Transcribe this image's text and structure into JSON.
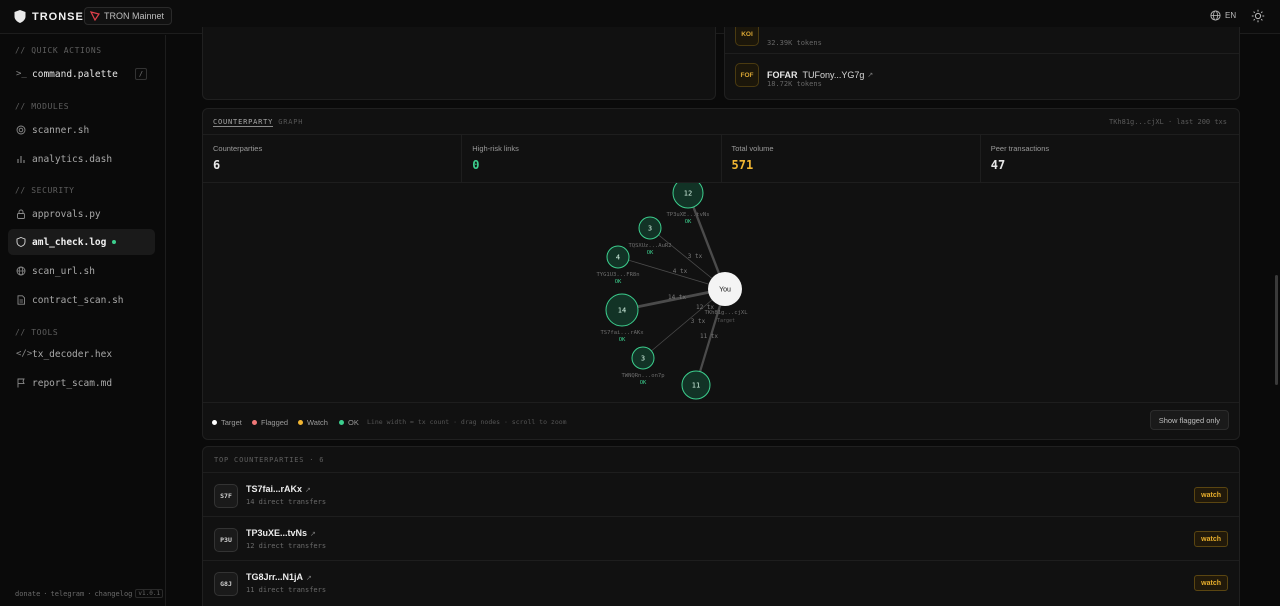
{
  "topbar": {
    "brand": "TRONSEC",
    "network": "TRON Mainnet",
    "language": "EN"
  },
  "sidebar": {
    "quick_actions_heading": "// QUICK ACTIONS",
    "command_palette": "command.palette",
    "command_palette_key": "/",
    "modules_heading": "// MODULES",
    "modules": [
      "scanner.sh",
      "analytics.dash"
    ],
    "security_heading": "// SECURITY",
    "security": [
      "approvals.py",
      "aml_check.log",
      "scan_url.sh",
      "contract_scan.sh"
    ],
    "tools_heading": "// TOOLS",
    "tools": [
      "tx_decoder.hex",
      "report_scam.md"
    ],
    "footer": {
      "donate": "donate",
      "telegram": "telegram",
      "changelog": "changelog",
      "version": "v1.0.1",
      "sep": "·"
    }
  },
  "tokens": [
    {
      "badge": "KOI",
      "name": "",
      "address": "",
      "amount": "32.39K tokens"
    },
    {
      "badge": "FOF",
      "name": "FOFAR",
      "address": "TUFony...YG7g",
      "amount": "18.72K tokens"
    }
  ],
  "graph": {
    "title_main": "COUNTERPARTY",
    "title_sub": "GRAPH",
    "meta": "TKh81g...cjXL · last 200 txs",
    "stats": [
      {
        "label": "Counterparties",
        "value": "6"
      },
      {
        "label": "High-risk links",
        "value": "0"
      },
      {
        "label": "Total volume",
        "value": "571"
      },
      {
        "label": "Peer transactions",
        "value": "47"
      }
    ],
    "center": {
      "label": "You",
      "address": "TKh81g...cjXL",
      "role": "Target"
    },
    "nodes": [
      {
        "count": "12",
        "address": "TP3uXE...tvNs",
        "status": "OK",
        "edge": "12 tx"
      },
      {
        "count": "3",
        "address": "TQSXUz...AuR2",
        "status": "OK",
        "edge": "3 tx"
      },
      {
        "count": "4",
        "address": "TYG1U3...FR8n",
        "status": "OK",
        "edge": "4 tx"
      },
      {
        "count": "14",
        "address": "TS7fai...rAKx",
        "status": "OK",
        "edge": "14 tx"
      },
      {
        "count": "3",
        "address": "TWNQRn...on7p",
        "status": "OK",
        "edge": "3 tx"
      },
      {
        "count": "11",
        "address": "",
        "status": "",
        "edge": "11 tx"
      }
    ],
    "legend": {
      "target": "Target",
      "flagged": "Flagged",
      "watch": "Watch",
      "ok": "OK",
      "hint": "Line width ≈ tx count · drag nodes · scroll to zoom",
      "button": "Show flagged only"
    }
  },
  "top_counterparties": {
    "heading": "TOP COUNTERPARTIES · 6",
    "rows": [
      {
        "badge": "S7F",
        "address": "TS7fai...rAKx",
        "meta": "14 direct transfers",
        "action": "watch"
      },
      {
        "badge": "P3U",
        "address": "TP3uXE...tvNs",
        "meta": "12 direct transfers",
        "action": "watch"
      },
      {
        "badge": "G8J",
        "address": "TG8Jrr...N1jA",
        "meta": "11 direct transfers",
        "action": "watch"
      }
    ]
  },
  "colors": {
    "ok": "#3ccf8e",
    "flagged": "#f07878",
    "watch": "#f2b632",
    "target": "#ffffff",
    "accent_gold": "#f2b632"
  }
}
